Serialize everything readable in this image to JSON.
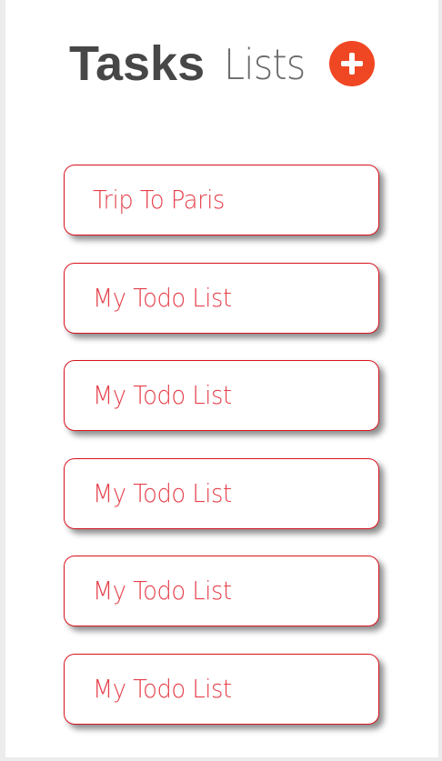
{
  "header": {
    "title_strong": "Tasks",
    "title_light": "Lists",
    "add_icon": "plus-circle-icon"
  },
  "colors": {
    "accent": "#ef4723",
    "card_border": "#d9141e",
    "card_text": "#e5404a",
    "title_dark": "#474747",
    "title_light": "#6b6b6b"
  },
  "lists": [
    {
      "label": "Trip To Paris"
    },
    {
      "label": "My Todo List"
    },
    {
      "label": "My Todo List"
    },
    {
      "label": "My Todo List"
    },
    {
      "label": "My Todo List"
    },
    {
      "label": "My Todo List"
    }
  ]
}
